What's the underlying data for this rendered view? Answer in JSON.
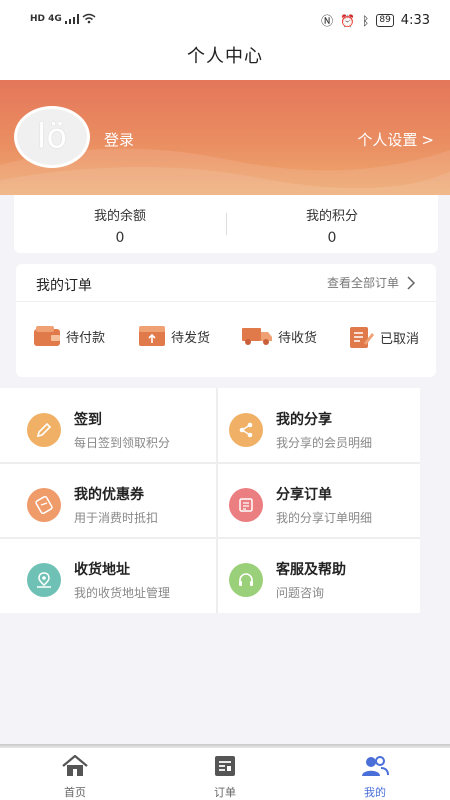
{
  "status_bar": {
    "network": "HD 4G",
    "battery": "89",
    "time": "4:33"
  },
  "header": {
    "title": "个人中心"
  },
  "profile": {
    "avatar_text": "lö",
    "login_label": "登录",
    "settings_label": "个人设置",
    "settings_chevron": ">"
  },
  "balance": {
    "balance_label": "我的余额",
    "balance_value": "0",
    "points_label": "我的积分",
    "points_value": "0"
  },
  "orders": {
    "title": "我的订单",
    "view_all": "查看全部订单",
    "items": [
      {
        "label": "待付款",
        "icon": "wallet-icon"
      },
      {
        "label": "待发货",
        "icon": "box-upload-icon"
      },
      {
        "label": "待收货",
        "icon": "truck-icon"
      },
      {
        "label": "已取消",
        "icon": "edit-doc-icon"
      }
    ]
  },
  "menu": [
    {
      "title": "签到",
      "subtitle": "每日签到领取积分",
      "icon": "pencil-icon",
      "color": "#f0b166"
    },
    {
      "title": "我的分享",
      "subtitle": "我分享的会员明细",
      "icon": "share-icon",
      "color": "#f0b166"
    },
    {
      "title": "我的优惠券",
      "subtitle": "用于消费时抵扣",
      "icon": "coupon-icon",
      "color": "#ef9b6a"
    },
    {
      "title": "分享订单",
      "subtitle": "我的分享订单明细",
      "icon": "document-icon",
      "color": "#ea7e80"
    },
    {
      "title": "收货地址",
      "subtitle": "我的收货地址管理",
      "icon": "location-icon",
      "color": "#6fc1b6"
    },
    {
      "title": "客服及帮助",
      "subtitle": "问题咨询",
      "icon": "headset-icon",
      "color": "#9bd07a"
    }
  ],
  "tabbar": {
    "items": [
      {
        "label": "首页",
        "icon": "home-icon",
        "active": false
      },
      {
        "label": "订单",
        "icon": "order-list-icon",
        "active": false
      },
      {
        "label": "我的",
        "icon": "user-group-icon",
        "active": true
      }
    ],
    "accent": "#4a6fd8"
  }
}
